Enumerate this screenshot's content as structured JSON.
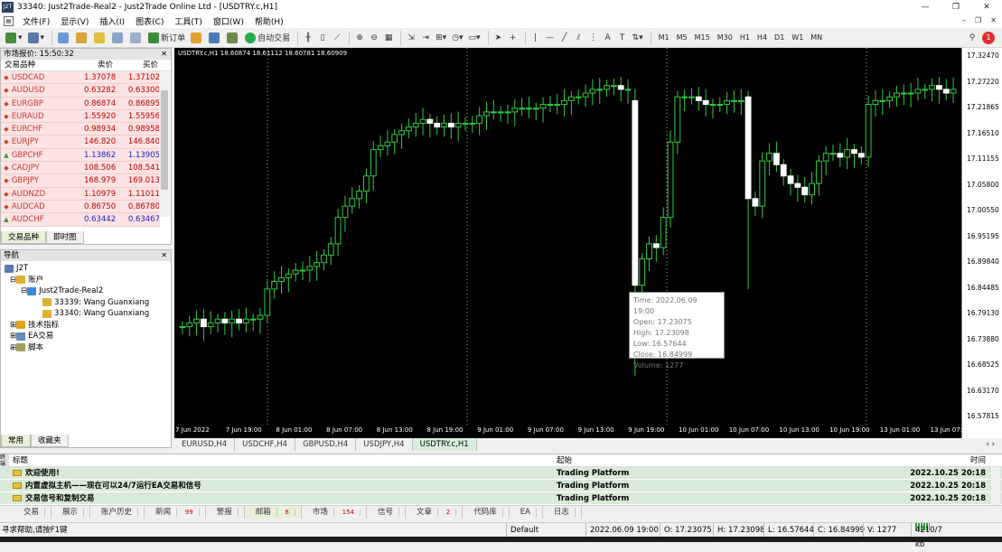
{
  "window": {
    "title": "33340: Just2Trade-Real2 - Just2Trade Online Ltd - [USDTRY.c,H1]",
    "logo": "J2T"
  },
  "menu": [
    "文件(F)",
    "显示(V)",
    "插入(I)",
    "图表(C)",
    "工具(T)",
    "窗口(W)",
    "帮助(H)"
  ],
  "toolbar": {
    "new_order": "新订单",
    "auto_trade": "自动交易",
    "timeframes": [
      "M1",
      "M5",
      "M15",
      "M30",
      "H1",
      "H4",
      "D1",
      "W1",
      "MN"
    ]
  },
  "market_watch": {
    "title": "市场报价: 15:50:32",
    "col_symbol": "交易品种",
    "col_bid": "卖价",
    "col_ask": "买价",
    "rows": [
      {
        "symbol": "USDCAD",
        "bid": "1.37078",
        "ask": "1.37102",
        "color": "#c00000"
      },
      {
        "symbol": "AUDUSD",
        "bid": "0.63282",
        "ask": "0.63300",
        "color": "#c00000"
      },
      {
        "symbol": "EURGBP",
        "bid": "0.86874",
        "ask": "0.86895",
        "color": "#c00000"
      },
      {
        "symbol": "EURAUD",
        "bid": "1.55920",
        "ask": "1.55956",
        "color": "#c00000"
      },
      {
        "symbol": "EURCHF",
        "bid": "0.98934",
        "ask": "0.98958",
        "color": "#c00000"
      },
      {
        "symbol": "EURJPY",
        "bid": "146.820",
        "ask": "146.840",
        "color": "#c00000"
      },
      {
        "symbol": "GBPCHF",
        "bid": "1.13862",
        "ask": "1.13905",
        "color": "#1a1acc"
      },
      {
        "symbol": "CADJPY",
        "bid": "108.506",
        "ask": "108.541",
        "color": "#c00000"
      },
      {
        "symbol": "GBPJPY",
        "bid": "168.979",
        "ask": "169.013",
        "color": "#c00000"
      },
      {
        "symbol": "AUDNZD",
        "bid": "1.10979",
        "ask": "1.11011",
        "color": "#c00000"
      },
      {
        "symbol": "AUDCAD",
        "bid": "0.86750",
        "ask": "0.86780",
        "color": "#c00000"
      },
      {
        "symbol": "AUDCHF",
        "bid": "0.63442",
        "ask": "0.63467",
        "color": "#1a1acc"
      }
    ],
    "tabs": [
      "交易品种",
      "即时图"
    ]
  },
  "navigator": {
    "title": "导航",
    "root": "J2T",
    "accounts_label": "账户",
    "server": "Just2Trade-Real2",
    "accounts": [
      "33339: Wang Guanxiang",
      "33340: Wang Guanxiang"
    ],
    "indicators": "技术指标",
    "experts": "EA交易",
    "scripts": "脚本",
    "tabs": [
      "常用",
      "收藏夹"
    ]
  },
  "chart": {
    "label": "USDTRY.c,H1  18.60874 18.61112 18.60781 18.60909",
    "price_ticks": [
      "17.32470",
      "17.27220",
      "17.21865",
      "17.16510",
      "17.11155",
      "17.05800",
      "17.00550",
      "16.95195",
      "16.89840",
      "16.84485",
      "16.79130",
      "16.73880",
      "16.68525",
      "16.63170",
      "16.57815"
    ],
    "time_ticks": [
      "7 Jun 2022",
      "7 Jun 19:00",
      "8 Jun 01:00",
      "8 Jun 07:00",
      "8 Jun 13:00",
      "8 Jun 19:00",
      "9 Jun 01:00",
      "9 Jun 07:00",
      "9 Jun 13:00",
      "9 Jun 19:00",
      "10 Jun 01:00",
      "10 Jun 07:00",
      "10 Jun 13:00",
      "10 Jun 19:00",
      "13 Jun 01:00",
      "13 Jun 07:00"
    ],
    "tooltip": {
      "time": "Time: 2022.06.09 19:00",
      "open": "Open: 17.23075",
      "high": "High: 17.23098",
      "low": "Low:  16.57644",
      "close": "Close: 16.84999",
      "volume": "Volume: 1277"
    }
  },
  "chart_tabs": [
    "EURUSD,H4",
    "USDCHF,H4",
    "GBPUSD,H4",
    "USDJPY,H4",
    "USDTRY.c,H1"
  ],
  "terminal": {
    "col_title": "标题",
    "col_source": "起始",
    "col_time": "时间",
    "rows": [
      {
        "title": "欢迎使用!",
        "source": "Trading Platform",
        "time": "2022.10.25 20:18"
      },
      {
        "title": "内置虚拟主机——现在可以24/7运行EA交易和信号",
        "source": "Trading Platform",
        "time": "2022.10.25 20:18"
      },
      {
        "title": "交易信号和复制交易",
        "source": "Trading Platform",
        "time": "2022.10.25 20:18"
      }
    ],
    "tabs": [
      {
        "label": "交易",
        "count": ""
      },
      {
        "label": "展示",
        "count": ""
      },
      {
        "label": "账户历史",
        "count": ""
      },
      {
        "label": "新闻",
        "count": "99"
      },
      {
        "label": "警报",
        "count": ""
      },
      {
        "label": "邮箱",
        "count": "8"
      },
      {
        "label": "市场",
        "count": "154"
      },
      {
        "label": "信号",
        "count": ""
      },
      {
        "label": "文章",
        "count": "2"
      },
      {
        "label": "代码库",
        "count": ""
      },
      {
        "label": "EA",
        "count": ""
      },
      {
        "label": "日志",
        "count": ""
      }
    ],
    "side_label": "终端"
  },
  "status": {
    "help": "寻求帮助,请按F1键",
    "profile": "Default",
    "time": "2022.06.09 19:00",
    "open": "O: 17.23075",
    "high": "H: 17.23098",
    "low": "L: 16.57644",
    "close": "C: 16.84999",
    "volume": "V: 1277",
    "traffic": "4210/7 kb"
  }
}
